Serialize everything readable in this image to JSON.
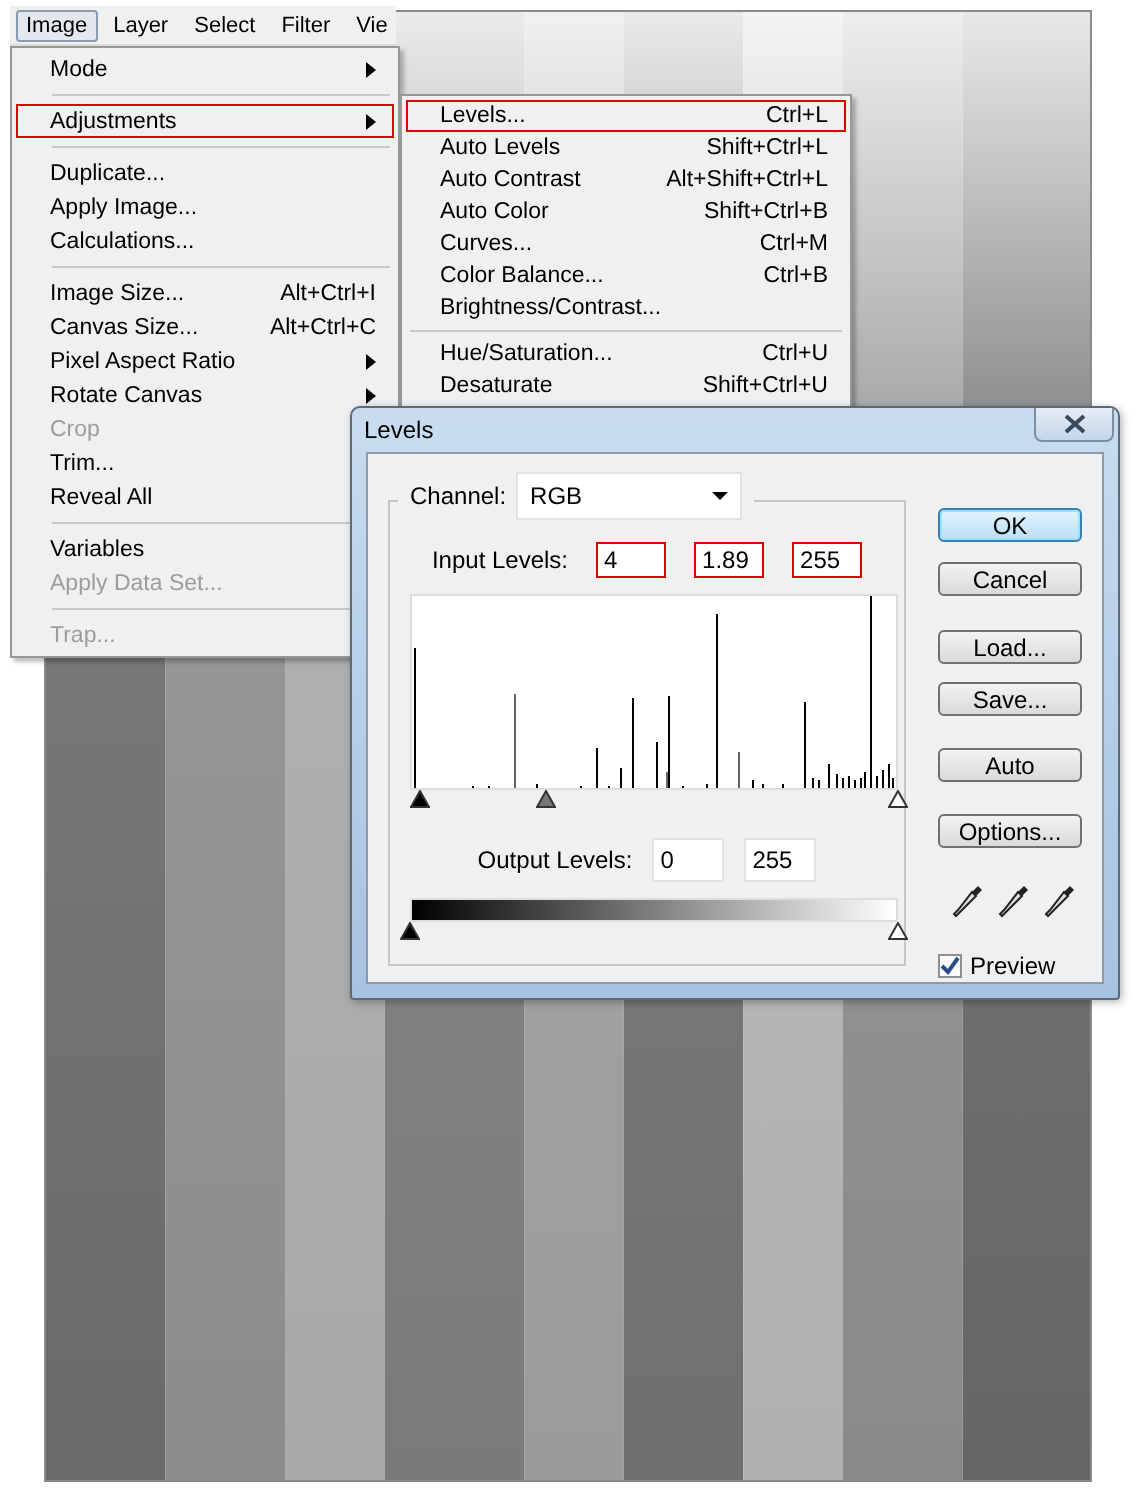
{
  "menu_bar": {
    "items": [
      {
        "label": "Image",
        "selected": true
      },
      {
        "label": "Layer",
        "selected": false
      },
      {
        "label": "Select",
        "selected": false
      },
      {
        "label": "Filter",
        "selected": false
      },
      {
        "label": "Vie",
        "selected": false
      }
    ]
  },
  "image_menu": {
    "items": [
      {
        "kind": "submenu",
        "label": "Mode",
        "disabled": false,
        "outlined": false
      },
      {
        "kind": "separator"
      },
      {
        "kind": "submenu",
        "label": "Adjustments",
        "disabled": false,
        "outlined": true
      },
      {
        "kind": "separator"
      },
      {
        "kind": "item",
        "label": "Duplicate...",
        "disabled": false,
        "outlined": false
      },
      {
        "kind": "item",
        "label": "Apply Image...",
        "disabled": false,
        "outlined": false
      },
      {
        "kind": "item",
        "label": "Calculations...",
        "disabled": false,
        "outlined": false
      },
      {
        "kind": "separator"
      },
      {
        "kind": "item",
        "label": "Image Size...",
        "shortcut": "Alt+Ctrl+I",
        "disabled": false,
        "outlined": false
      },
      {
        "kind": "item",
        "label": "Canvas Size...",
        "shortcut": "Alt+Ctrl+C",
        "disabled": false,
        "outlined": false
      },
      {
        "kind": "submenu",
        "label": "Pixel Aspect Ratio",
        "disabled": false,
        "outlined": false
      },
      {
        "kind": "submenu",
        "label": "Rotate Canvas",
        "disabled": false,
        "outlined": false
      },
      {
        "kind": "item",
        "label": "Crop",
        "disabled": true,
        "outlined": false
      },
      {
        "kind": "item",
        "label": "Trim...",
        "disabled": false,
        "outlined": false
      },
      {
        "kind": "item",
        "label": "Reveal All",
        "disabled": false,
        "outlined": false
      },
      {
        "kind": "separator"
      },
      {
        "kind": "item",
        "label": "Variables",
        "disabled": false,
        "outlined": false
      },
      {
        "kind": "item",
        "label": "Apply Data Set...",
        "disabled": true,
        "outlined": false
      },
      {
        "kind": "separator"
      },
      {
        "kind": "item",
        "label": "Trap...",
        "disabled": true,
        "outlined": false
      }
    ]
  },
  "adjustments_menu": {
    "items": [
      {
        "kind": "item",
        "label": "Levels...",
        "shortcut": "Ctrl+L",
        "outlined": true
      },
      {
        "kind": "item",
        "label": "Auto Levels",
        "shortcut": "Shift+Ctrl+L",
        "outlined": false
      },
      {
        "kind": "item",
        "label": "Auto Contrast",
        "shortcut": "Alt+Shift+Ctrl+L",
        "outlined": false
      },
      {
        "kind": "item",
        "label": "Auto Color",
        "shortcut": "Shift+Ctrl+B",
        "outlined": false
      },
      {
        "kind": "item",
        "label": "Curves...",
        "shortcut": "Ctrl+M",
        "outlined": false
      },
      {
        "kind": "item",
        "label": "Color Balance...",
        "shortcut": "Ctrl+B",
        "outlined": false
      },
      {
        "kind": "item",
        "label": "Brightness/Contrast...",
        "outlined": false
      },
      {
        "kind": "separator"
      },
      {
        "kind": "item",
        "label": "Hue/Saturation...",
        "shortcut": "Ctrl+U",
        "outlined": false
      },
      {
        "kind": "item",
        "label": "Desaturate",
        "shortcut": "Shift+Ctrl+U",
        "outlined": false
      }
    ]
  },
  "levels_dialog": {
    "title": "Levels",
    "channel": {
      "label": "Channel:",
      "value": "RGB"
    },
    "input_levels": {
      "label": "Input Levels:",
      "fields": [
        {
          "value": "4",
          "outlined": true
        },
        {
          "value": "1.89",
          "outlined": true
        },
        {
          "value": "255",
          "outlined": true
        }
      ]
    },
    "input_sliders": [
      {
        "kind": "black",
        "level": 0.02
      },
      {
        "kind": "gray",
        "level": 0.28
      },
      {
        "kind": "white",
        "level": 1
      }
    ],
    "output_levels": {
      "label": "Output Levels:",
      "fields": [
        {
          "value": "0",
          "outlined": false
        },
        {
          "value": "255",
          "outlined": false
        }
      ]
    },
    "output_sliders": [
      {
        "kind": "black",
        "level": 0
      },
      {
        "kind": "white",
        "level": 1
      }
    ],
    "buttons": [
      {
        "label": "OK",
        "default": true
      },
      {
        "label": "Cancel",
        "default": false
      },
      {
        "label": "Load...",
        "default": false
      },
      {
        "label": "Save...",
        "default": false
      },
      {
        "label": "Auto",
        "default": false
      },
      {
        "label": "Options...",
        "default": false
      }
    ],
    "preview": {
      "label": "Preview",
      "checked": true
    }
  }
}
